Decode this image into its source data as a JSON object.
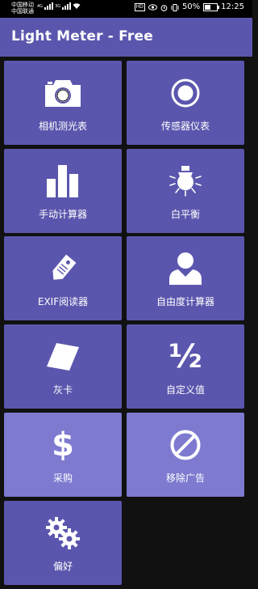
{
  "status_bar": {
    "carrier_1": "中国移动",
    "carrier_2": "中国联通",
    "net_1": "4G",
    "net_2": "3G",
    "hd": "HD",
    "battery_percent": "50%",
    "battery_level": 0.5,
    "time": "12:25"
  },
  "app_bar": {
    "title": "Light Meter - Free"
  },
  "tiles": [
    {
      "label": "相机测光表",
      "icon": "camera-icon"
    },
    {
      "label": "传感器仪表",
      "icon": "sensor-icon"
    },
    {
      "label": "手动计算器",
      "icon": "bar-chart-icon"
    },
    {
      "label": "白平衡",
      "icon": "lightbulb-icon"
    },
    {
      "label": "EXIF阅读器",
      "icon": "tag-icon"
    },
    {
      "label": "自由度计算器",
      "icon": "person-icon"
    },
    {
      "label": "灰卡",
      "icon": "card-icon"
    },
    {
      "label": "自定义值",
      "icon": "one-half-icon",
      "symbol": "½"
    },
    {
      "label": "采购",
      "icon": "dollar-icon",
      "symbol": "$"
    },
    {
      "label": "移除广告",
      "icon": "prohibited-icon"
    },
    {
      "label": "偏好",
      "icon": "gears-icon"
    }
  ],
  "colors": {
    "tile": "#5b56ad",
    "tile_highlight": "#7d7ad0",
    "background": "#111111"
  }
}
